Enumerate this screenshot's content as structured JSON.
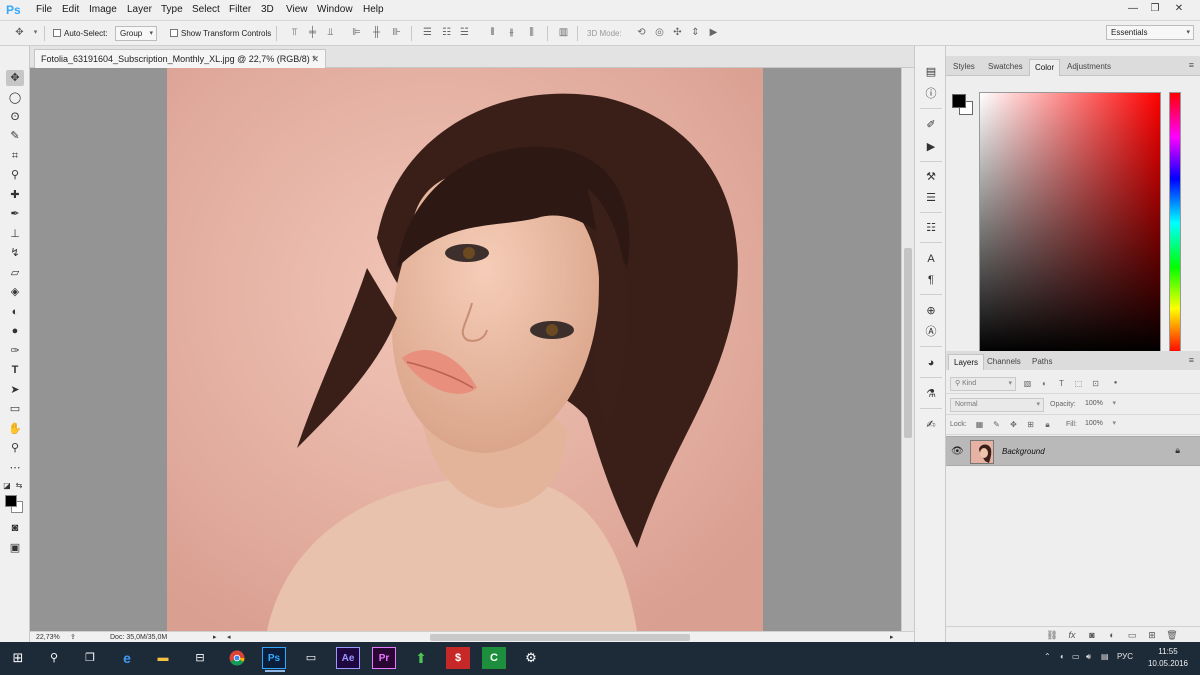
{
  "app": {
    "logo": "Ps"
  },
  "menu": {
    "items": [
      "File",
      "Edit",
      "Image",
      "Layer",
      "Type",
      "Select",
      "Filter",
      "3D",
      "View",
      "Window",
      "Help"
    ]
  },
  "window_controls": {
    "minimize": "—",
    "restore": "❐",
    "close": "✕"
  },
  "options": {
    "auto_select_label": "Auto-Select:",
    "auto_select_checked": false,
    "group_value": "Group",
    "show_transform_label": "Show Transform Controls",
    "show_transform_checked": false,
    "mode_3d_label": "3D Mode:"
  },
  "workspace": {
    "value": "Essentials"
  },
  "document": {
    "tab_title": "Fotolia_63191604_Subscription_Monthly_XL.jpg @ 22,7% (RGB/8) *",
    "tab_close": "✕"
  },
  "status": {
    "zoom": "22,73%",
    "doc_info": "Doc: 35,0M/35,0M"
  },
  "color_panel": {
    "tabs": [
      "Styles",
      "Swatches",
      "Color",
      "Adjustments"
    ],
    "active_tab": "Color",
    "foreground": "#000000",
    "background": "#ffffff",
    "hue": "#ff0000"
  },
  "layers_panel": {
    "tabs": [
      "Layers",
      "Channels",
      "Paths"
    ],
    "active_tab": "Layers",
    "filter_kind": "Kind",
    "blend_mode": "Normal",
    "opacity_label": "Opacity:",
    "opacity_value": "100%",
    "lock_label": "Lock:",
    "fill_label": "Fill:",
    "fill_value": "100%",
    "layers": [
      {
        "name": "Background",
        "visible": true,
        "locked": true
      }
    ]
  },
  "taskbar": {
    "language": "РУС",
    "time": "11:55",
    "date": "10.05.2016",
    "apps": [
      "start-icon",
      "search-icon",
      "task-view-icon",
      "edge-icon",
      "file-explorer-icon",
      "store-icon",
      "chrome-icon",
      "photoshop-icon",
      "app-window-icon",
      "after-effects-icon",
      "premiere-icon",
      "upload-arrow-icon",
      "app-red-icon",
      "camtasia-icon",
      "settings-icon"
    ]
  },
  "colors": {
    "accent": "#31a8ff",
    "taskbar": "#1d2a38",
    "canvas_bg": "#949494"
  }
}
